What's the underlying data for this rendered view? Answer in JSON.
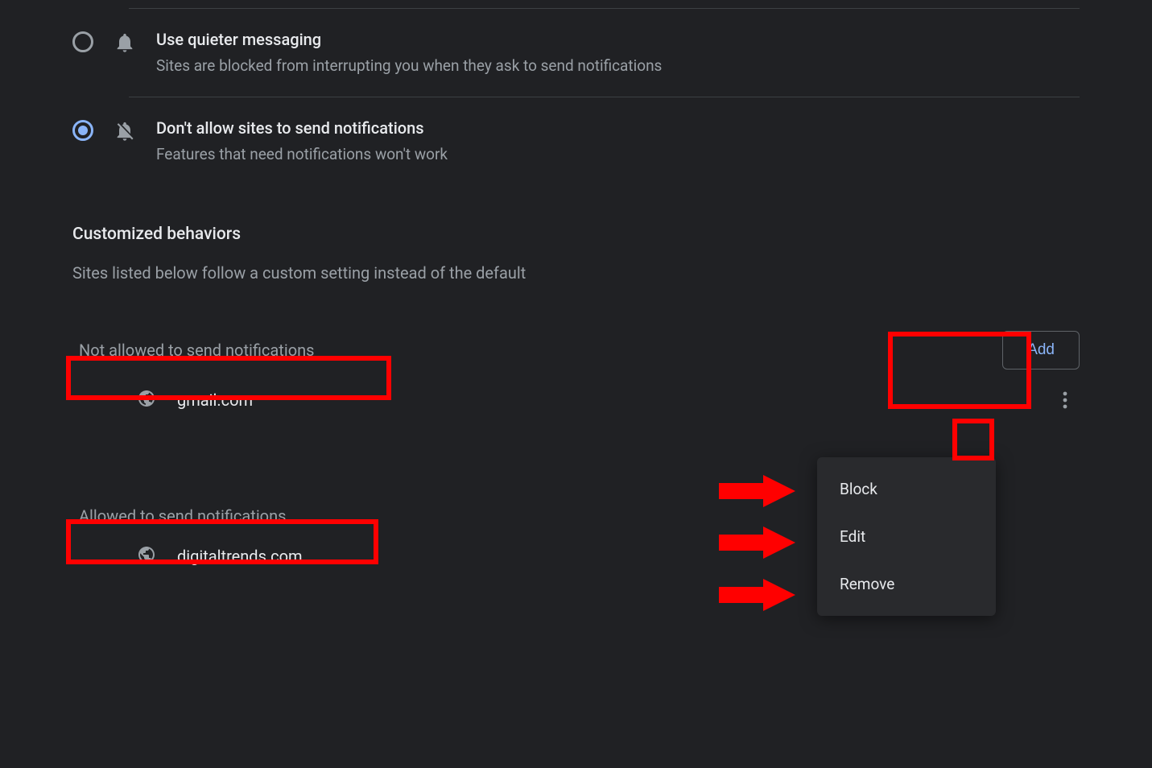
{
  "options": {
    "quieter": {
      "title": "Use quieter messaging",
      "desc": "Sites are blocked from interrupting you when they ask to send notifications",
      "selected": false
    },
    "block": {
      "title": "Don't allow sites to send notifications",
      "desc": "Features that need notifications won't work",
      "selected": true
    }
  },
  "customized": {
    "heading": "Customized behaviors",
    "desc": "Sites listed below follow a custom setting instead of the default"
  },
  "not_allowed": {
    "title": "Not allowed to send notifications",
    "add_label": "Add",
    "sites": [
      {
        "name": "gmail.com"
      }
    ]
  },
  "allowed": {
    "title": "Allowed to send notifications",
    "sites": [
      {
        "name": "digitaltrends.com"
      }
    ]
  },
  "menu": {
    "block": "Block",
    "edit": "Edit",
    "remove": "Remove"
  }
}
